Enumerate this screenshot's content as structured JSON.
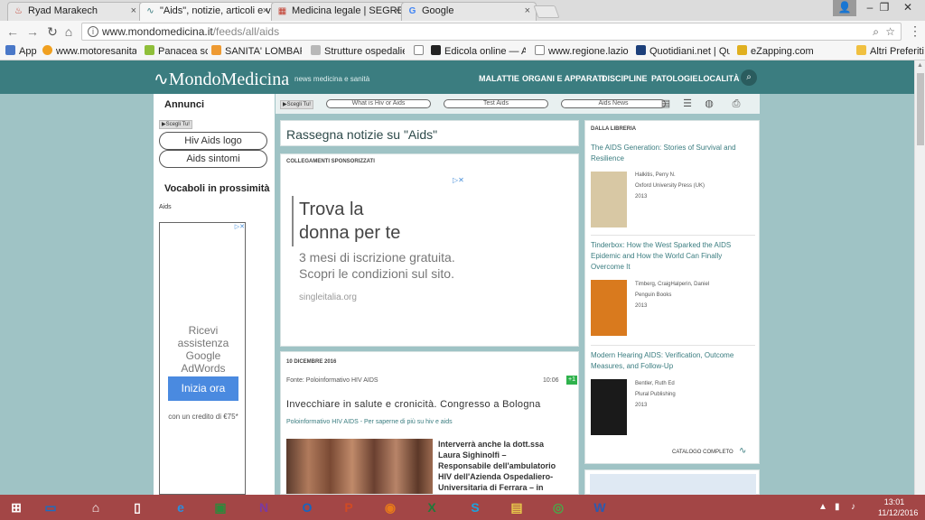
{
  "tabs": [
    {
      "title": "Ryad Marakech",
      "icon": "hotel-icon",
      "close": "×"
    },
    {
      "title": "\"Aids\", notizie, articoli e v",
      "icon": "pulse-icon",
      "close": "×"
    },
    {
      "title": "Medicina legale | SEGRET",
      "icon": "document-icon",
      "close": "×"
    },
    {
      "title": "Google",
      "icon": "google-icon",
      "close": "×"
    }
  ],
  "address": {
    "host": "www.mondomedicina.it",
    "path": "/feeds/all/aids"
  },
  "bookmarks": [
    "App",
    "www.motoresanita.it",
    "Panacea scs",
    "SANITA' LOMBARDA",
    "Strutture ospedaliere",
    "",
    "Edicola online — Asse",
    "www.regione.lazio.it/",
    "Quotidiani.net | Quoti",
    "eZapping.com",
    "Altri Preferiti"
  ],
  "site": {
    "logo": "MondoMedicina",
    "tagline": "news medicina e sanità",
    "nav": [
      "MALATTIE",
      "ORGANI E APPARATI",
      "DISCIPLINE",
      "PATOLOGIE",
      "LOCALITÀ"
    ]
  },
  "left": {
    "annunci": "Annunci",
    "ad_choices": "Scegli Tu!",
    "pills": [
      "Hiv Aids logo",
      "Aids sintomi"
    ],
    "vocab_title": "Vocaboli in prossimità",
    "vocab_item": "Aids",
    "ad": {
      "text": "Ricevi assistenza Google AdWords gratuita",
      "button": "Inizia ora",
      "credit": "con un credito di €75*"
    }
  },
  "toolbar": {
    "ad_choices": "Scegli Tu!",
    "pills": [
      "What is Hiv or Aids",
      "Test Aids",
      "Aids News"
    ]
  },
  "main": {
    "heading": "Rassegna notizie su \"Aids\"",
    "sponsored": "COLLEGAMENTI SPONSORIZZATI",
    "ad": {
      "line1": "Trova la",
      "line2": "donna per te",
      "line3": "3 mesi di iscrizione gratuita.",
      "line4": "Scopri le condizioni sul sito.",
      "url": "singleitalia.org"
    },
    "news": {
      "date": "10 DICEMBRE 2016",
      "source": "Fonte: Poloinformativo HIV AIDS",
      "time": "10:06",
      "plus": "+1",
      "title": "Invecchiare in salute e cronicità. Congresso a Bologna",
      "src_line": "Poloinformativo HIV AIDS - Per saperne di più su hiv e aids",
      "body": "Interverrà anche la dott.ssa Laura Sighinolfi – Responsabile dell'ambulatorio HIV dell'Azienda Ospedaliero-Universitaria di Ferrara – in"
    }
  },
  "library": {
    "head": "DALLA LIBRERIA",
    "books": [
      {
        "title": "The AIDS Generation: Stories of Survival and Resilience",
        "author": "Halkitis, Perry N.",
        "publisher": "Oxford University Press (UK)",
        "year": "2013",
        "cover": "#d8c8a4"
      },
      {
        "title": "Tinderbox: How the West Sparked the AIDS Epidemic and How the World Can Finally Overcome It",
        "author": "Timberg, CraigHalperin, Daniel",
        "publisher": "Penguin Books",
        "year": "2013",
        "cover": "#d97a1e"
      },
      {
        "title": "Modern Hearing AIDS: Verification, Outcome Measures, and Follow-Up",
        "author": "Bentler, Ruth Ed",
        "publisher": "Plural Publishing",
        "year": "2013",
        "cover": "#1a1a1a"
      }
    ],
    "catalog": "CATALOGO COMPLETO"
  },
  "taskbar": {
    "time": "13:01",
    "date": "11/12/2016",
    "apps": [
      "windows-icon",
      "lenovo-icon",
      "home-icon",
      "file-icon",
      "ie-icon",
      "store-icon",
      "onenote-icon",
      "outlook-icon",
      "powerpoint-icon",
      "firefox-icon",
      "excel-icon",
      "skype-icon",
      "explorer-icon",
      "chrome-icon",
      "word-icon"
    ],
    "app_labels": [
      "⊞",
      "▭",
      "⌂",
      "▯",
      "e",
      "▣",
      "N",
      "O",
      "P",
      "◉",
      "X",
      "S",
      "▤",
      "◎",
      "W"
    ],
    "app_colors": [
      "#ffffff",
      "#1a6ec2",
      "#ffffff",
      "#ffffff",
      "#2a8fe0",
      "#2c8a3b",
      "#7b3aa0",
      "#1466c2",
      "#d04a24",
      "#e87a1a",
      "#1f7a3a",
      "#1aa3e0",
      "#e8c84a",
      "#4aa84a",
      "#2b5ab0"
    ]
  }
}
